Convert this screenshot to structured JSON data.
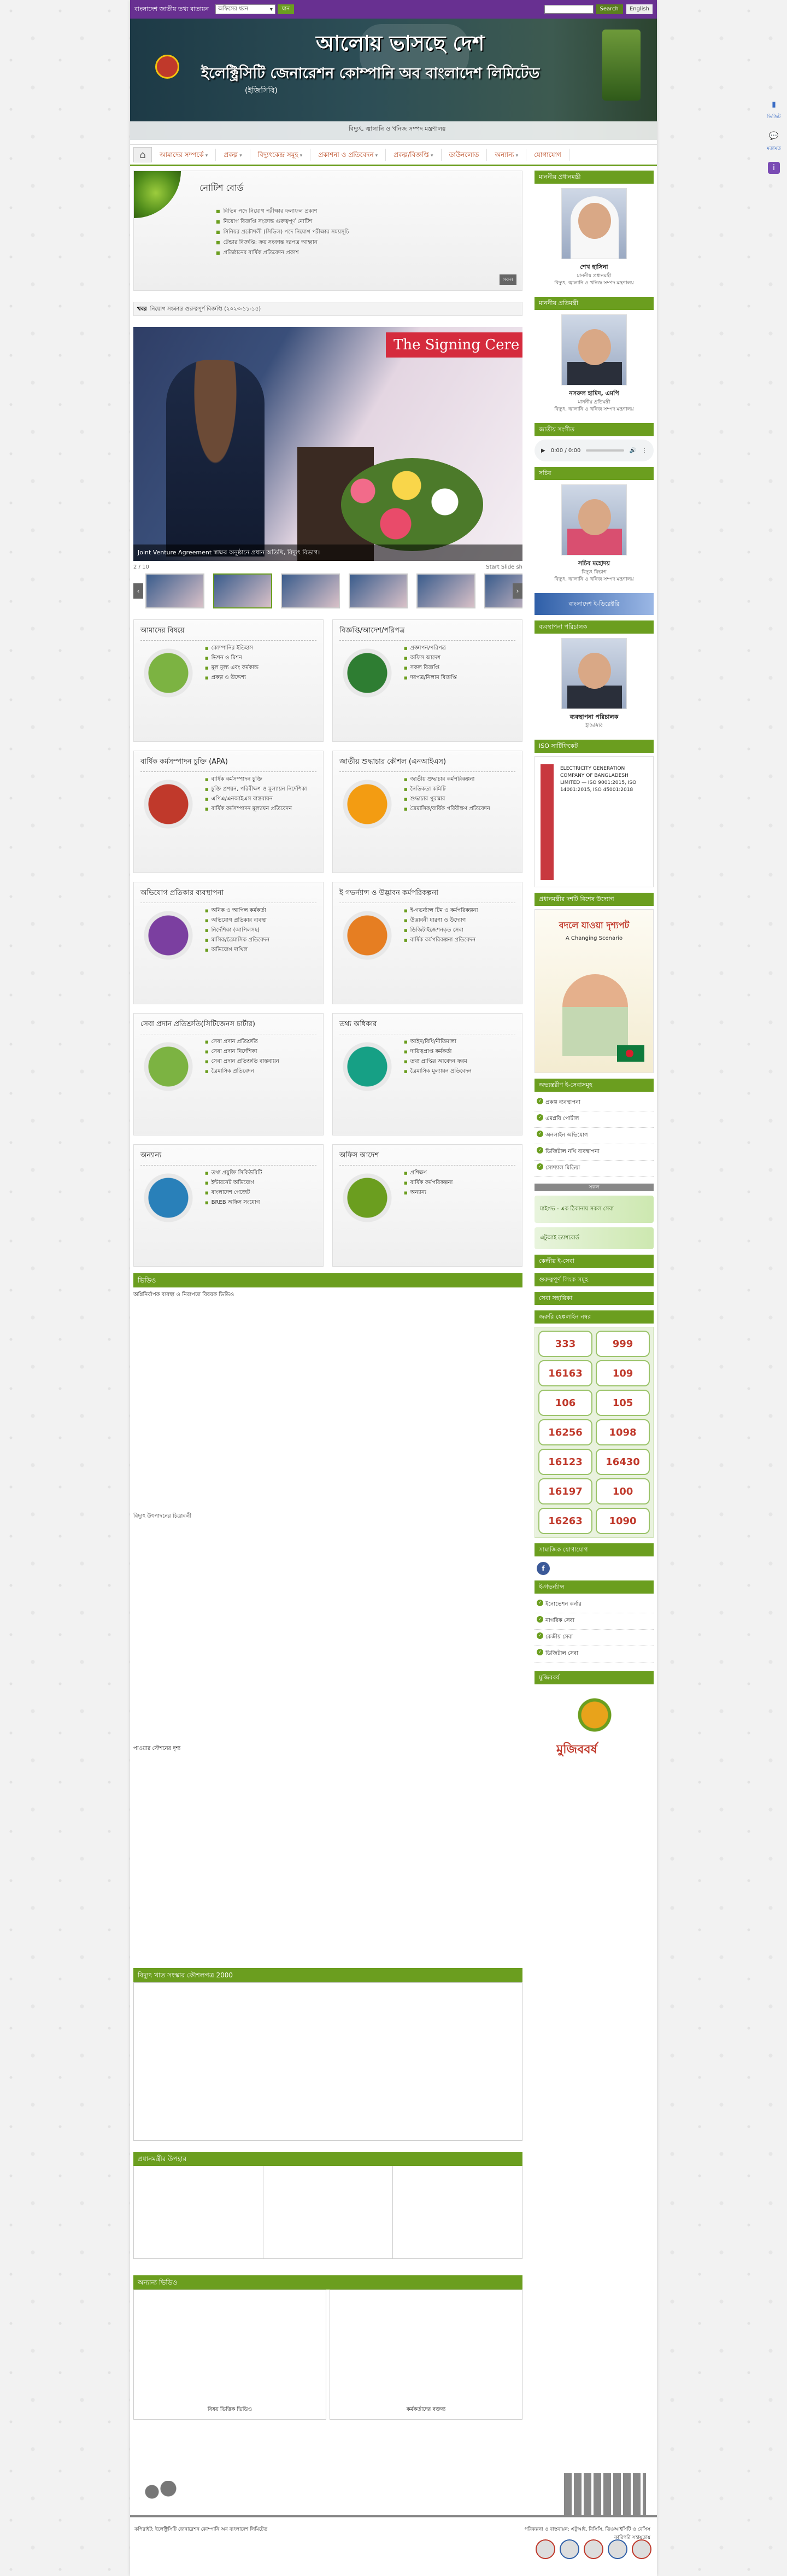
{
  "topbar": {
    "portal_label": "বাংলাদেশ জাতীয় তথ্য বাতায়ন",
    "select_value": "অফিসের ধরন",
    "go_label": "যান",
    "search_label": "Search",
    "lang_label": "English"
  },
  "banner": {
    "slogan": "আলোয় ভাসছে দেশ",
    "title": "ইলেক্ট্রিসিটি জেনারেশন কোম্পানি অব বাংলাদেশ লিমিটেড",
    "subtitle": "(ইজিসিবি)",
    "mantra": "বিদ্যুৎ, জ্বালানি ও খনিজ সম্পদ মন্ত্রণালয়"
  },
  "nav": {
    "items": [
      "আমাদের সম্পর্কে",
      "প্রকল্প",
      "বিদ্যুৎকেন্দ্র সমূহ",
      "প্রকাশনা ও প্রতিবেদন",
      "প্রকল্প/বিজ্ঞপ্তি",
      "ডাউনলোড",
      "অন্যান্য",
      "যোগাযোগ"
    ]
  },
  "notice": {
    "title": "নোটিশ বোর্ড",
    "items": [
      "বিভিন্ন পদে নিয়োগ পরীক্ষার ফলাফল প্রকাশ",
      "নিয়োগ বিজ্ঞপ্তি সংক্রান্ত গুরুত্বপূর্ণ নোটিশ",
      "সিনিয়র প্রকৌশলী (সিভিল) পদে নিয়োগ পরীক্ষার সময়সূচি",
      "টেন্ডার বিজ্ঞপ্তি: ক্রয় সংক্রান্ত দরপত্র আহ্বান",
      "প্রতিষ্ঠানের বার্ষিক প্রতিবেদন প্রকাশ"
    ],
    "all_label": "সকল"
  },
  "marquee": {
    "label": "খবর",
    "text": "নিয়োগ সংক্রান্ত গুরুত্বপূর্ণ বিজ্ঞপ্তি (২০২৩-১১-১৫)"
  },
  "slider": {
    "sign": "The Signing Cere",
    "caption": "Joint Venture Agreement স্বাক্ষর অনুষ্ঠানে প্রধান অতিথি, বিদ্যুৎ বিভাগ।",
    "counter": "2 / 10",
    "slideshow": "Start Slide sh"
  },
  "boxes": [
    {
      "title": "আমাদের বিষয়ে",
      "items": [
        "কোম্পানির ইতিহাস",
        "ভিশন ও মিশন",
        "মূল মূল্য এবং কর্মকান্ড",
        "প্রকল্প ও উদ্দেশ্য"
      ],
      "icon": "people-icon",
      "color": "#7cb342"
    },
    {
      "title": "বিজ্ঞপ্তি/আদেশ/পরিপত্র",
      "items": [
        "প্রজ্ঞাপন/পরিপত্র",
        "অফিস আদেশ",
        "সকল বিজ্ঞপ্তি",
        "দরপত্র/নিলাম বিজ্ঞপ্তি"
      ],
      "icon": "download-icon",
      "color": "#2e7d32"
    },
    {
      "title": "বার্ষিক কর্মসম্পাদন চুক্তি (APA)",
      "items": [
        "বার্ষিক কর্মসম্পাদন চুক্তি",
        "চুক্তি প্রণয়ন, পরিবীক্ষণ ও মূল্যায়ন নির্দেশিকা",
        "এপিএ/এনআইএস বাস্তবায়ন",
        "বার্ষিক কর্মসম্পাদন মূল্যায়ন প্রতিবেদন"
      ],
      "icon": "apa-icon",
      "color": "#c0392b"
    },
    {
      "title": "জাতীয় শুদ্ধাচার কৌশল (এনআইএস)",
      "items": [
        "জাতীয় শুদ্ধাচার কর্মপরিকল্পনা",
        "নৈতিকতা কমিটি",
        "শুদ্ধাচার পুরস্কার",
        "ত্রৈমাসিক/বার্ষিক পরিবীক্ষণ প্রতিবেদন"
      ],
      "icon": "nis-icon",
      "color": "#f39c12"
    },
    {
      "title": "অভিযোগ প্রতিকার ব্যবস্থাপনা",
      "items": [
        "অনিক ও আপিল কর্মকর্তা",
        "অভিযোগ প্রতিকার ব্যবস্থা",
        "নির্দেশিকা (আপিলসহ)",
        "মাসিক/ত্রৈমাসিক প্রতিবেদন",
        "অভিযোগ দাখিল"
      ],
      "icon": "complaint-icon",
      "color": "#7b3fa0"
    },
    {
      "title": "ই গভর্ন্যান্স ও উদ্ভাবন কর্মপরিকল্পনা",
      "items": [
        "ই-গভর্ন্যান্স টিম ও কর্মপরিকল্পনা",
        "উদ্ভাবনী ধারণা ও উদ্যোগ",
        "ডিজিটাইজেশনকৃত সেবা",
        "বার্ষিক কর্মপরিকল্পনা প্রতিবেদন"
      ],
      "icon": "idea-icon",
      "color": "#e67e22"
    },
    {
      "title": "সেবা প্রদান প্রতিশ্রুতি(সিটিজেনস চার্টার)",
      "items": [
        "সেবা প্রদান প্রতিশ্রুতি",
        "সেবা প্রদান নির্দেশিকা",
        "সেবা প্রদান প্রতিশ্রুতি বাস্তবায়ন",
        "ত্রৈমাসিক প্রতিবেদন"
      ],
      "icon": "charter-icon",
      "color": "#7cb342"
    },
    {
      "title": "তথ্য অধিকার",
      "items": [
        "আইন/বিধি/নীতিমালা",
        "দায়িত্বপ্রাপ্ত কর্মকর্তা",
        "তথ্য প্রাপ্তির আবেদন ফরম",
        "ত্রৈমাসিক মূল্যায়ন প্রতিবেদন"
      ],
      "icon": "info-icon",
      "color": "#16a085"
    },
    {
      "title": "অন্যান্য",
      "items": [
        "তথ্য প্রযুক্তি সিকিউরিটি",
        "ইন্টারনেট অভিযোগ",
        "বাংলাদেশ গেজেট",
        "BREB অফিস সংযোগ"
      ],
      "icon": "cloud-icon",
      "color": "#2980b9"
    },
    {
      "title": "অফিস আদেশ",
      "items": [
        "প্রশিক্ষণ",
        "বার্ষিক কর্মপরিকল্পনা",
        "অন্যান্য"
      ],
      "icon": "order-icon",
      "color": "#6b9e1f"
    }
  ],
  "sections": {
    "video_bar": "ভিডিও",
    "video_label_1": "অগ্নিনির্বাপক ব্যবস্থা ও নিরাপত্তা বিষয়ক ভিডিও",
    "video_label_2": "বিদ্যুৎ উৎপাদনের চিত্রাবলী",
    "video_label_3": "পাওয়ার স্টেশনের দৃশ্য",
    "bar_2": "বিদ্যুৎ খাত সংস্কার কৌশলপত্র 2000",
    "bar_3": "প্রধানমন্ত্রীর উপহার",
    "bar_4": "অন্যান্য ভিডিও",
    "vid_cap_1": "বিষয় ভিত্তিক ভিডিও",
    "vid_cap_2": "কর্মকর্তাদের বক্তব্য"
  },
  "sidebar": {
    "pm_head": "মাননীয় প্রধানমন্ত্রী",
    "pm_name": "শেখ হাসিনা",
    "pm_desc": "মাননীয় প্রধানমন্ত্রী",
    "pm_desc2": "বিদ্যুৎ, জ্বালানি ও খনিজ সম্পদ মন্ত্রণালয়",
    "minister_head": "মাননীয় প্রতিমন্ত্রী",
    "minister_name": "নসরুল হামিদ, এমপি",
    "minister_desc": "মাননীয় প্রতিমন্ত্রী",
    "minister_desc2": "বিদ্যুৎ, জ্বালানি ও খনিজ সম্পদ মন্ত্রণালয়",
    "anthem_head": "জাতীয় সংগীত",
    "audio_time": "0:00 / 0:00",
    "secretary_head": "সচিব",
    "secretary_name": "সচিব মহোদয়",
    "secretary_desc": "বিদ্যুৎ বিভাগ",
    "secretary_desc2": "বিদ্যুৎ, জ্বালানি ও খনিজ সম্পদ মন্ত্রণালয়",
    "mygov_banner": "বাংলাদেশ ই-ডিরেক্টরি",
    "md_head": "ব্যবস্থাপনা পরিচালক",
    "md_name": "ব্যবস্থাপনা পরিচালক",
    "md_desc": "ইজিসিবি",
    "iso_head": "ISO সার্টিফিকেট",
    "iso_text": "ELECTRICITY GENERATION COMPANY OF BANGLADESH LIMITED — ISO 9001:2015, ISO 14001:2015, ISO 45001:2018",
    "book_head": "প্রধানমন্ত্রীর দশটি বিশেষ উদ্যোগ",
    "book_title": "বদলে যাওয়া দৃশ্যপট",
    "book_sub": "A Changing Scenario",
    "links_head": "অভ্যন্তরীণ ই-সেবাসমূহ",
    "links": [
      "প্রকল্প ব্যবস্থাপনা",
      "এমপ্লয়ি পোর্টাল",
      "অনলাইন অভিযোগ",
      "ডিজিটাল নথি ব্যবস্থাপনা",
      "সোশ্যাল মিডিয়া"
    ],
    "tabs_label": "সকল",
    "mygov_label": "মাইগভ - এক ঠিকানায় সকল সেবা",
    "dash_label": "এটুআই ড্যাশবোর্ড",
    "service_heads": [
      "কেন্দ্রীয় ই-সেবা",
      "গুরুত্বপূর্ণ লিংক সমূহ",
      "সেবা সহায়িকা"
    ],
    "emerg_head": "জরুরি হেল্পলাইন নম্বর",
    "emerg_numbers": [
      "333",
      "999",
      "16163",
      "109",
      "106",
      "105",
      "16256",
      "1098",
      "16123",
      "16430",
      "16197",
      "100",
      "16263",
      "1090"
    ],
    "social_head": "সামাজিক যোগাযোগ",
    "egov_head": "ই-গভর্ন্যান্স",
    "egov_links": [
      "ইনোভেশন কর্নার",
      "নাগরিক সেবা",
      "কেন্দ্রীয় সেবা",
      "ডিজিটাল সেবা"
    ],
    "mujib_head": "মুজিববর্ষ",
    "mujib_text": "মুজিববর্ষ"
  },
  "floater": {
    "f1": "ভিজিট",
    "f2": "মতামত"
  },
  "footer": {
    "left": "কপিরাইট: ইলেক্ট্রিসিটি জেনারেশন কোম্পানি অব বাংলাদেশ লিমিটেড",
    "right": "পরিকল্পনা ও বাস্তবায়ন: এটুআই, বিসিসি, ডিওআইসিটি ও বেসিস",
    "right2": "কারিগরি সহায়তায়"
  }
}
